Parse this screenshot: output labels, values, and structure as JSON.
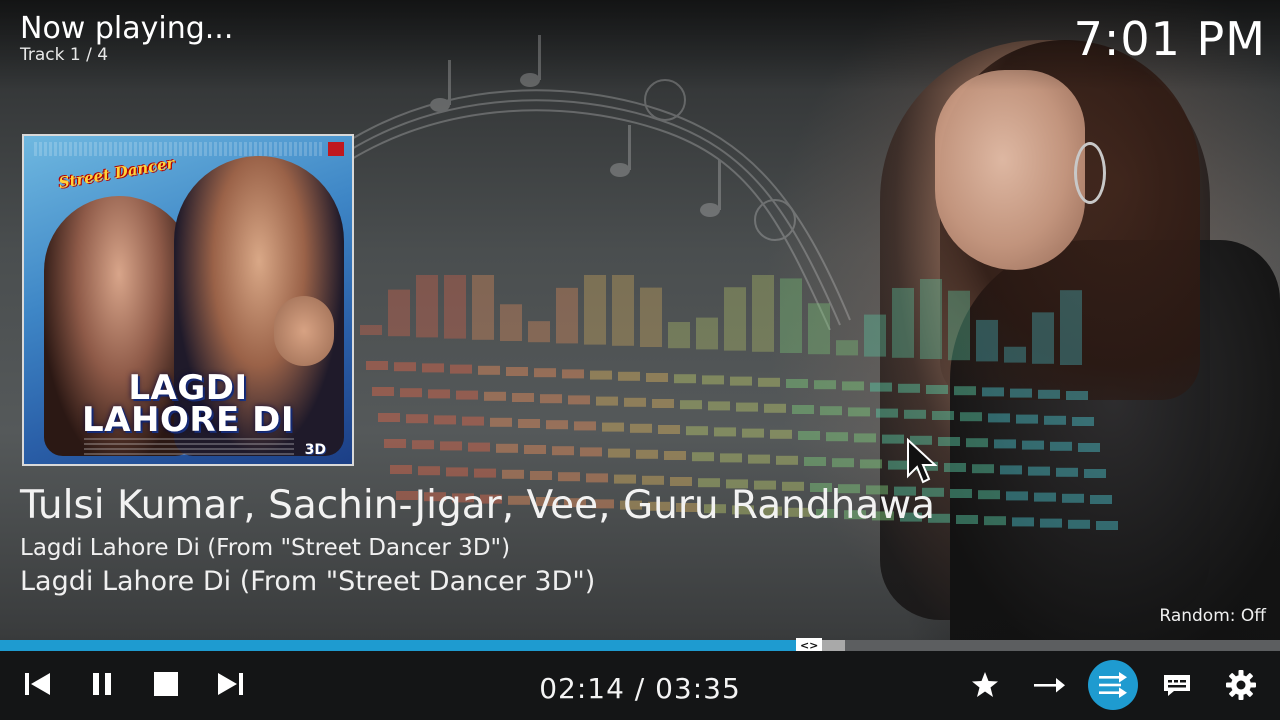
{
  "header": {
    "now_playing": "Now playing...",
    "track_count": "Track 1 / 4",
    "clock": "7:01 PM"
  },
  "album_art": {
    "title_line1": "LAGDI",
    "title_line2": "LAHORE DI",
    "badge": "3D",
    "logo": "Street Dancer"
  },
  "track": {
    "artist": "Tulsi Kumar, Sachin-Jigar, Vee, Guru Randhawa",
    "album": "Lagdi Lahore Di (From \"Street Dancer 3D\")",
    "title": "Lagdi Lahore Di (From \"Street Dancer 3D\")"
  },
  "random_status": "Random: Off",
  "progress": {
    "elapsed": "02:14",
    "total": "03:35",
    "time_display": "02:14 / 03:35",
    "fraction_played": 0.622,
    "fraction_cached": 0.66,
    "handle_glyph": "<>"
  },
  "controls": {
    "icons": [
      "previous-icon",
      "pause-icon",
      "stop-icon",
      "next-icon"
    ],
    "right_icons": [
      "favourite-star-icon",
      "repeat-arrow-icon",
      "party-mode-icon",
      "subtitles-icon",
      "settings-gear-icon"
    ]
  },
  "colors": {
    "accent": "#1e9bd0",
    "osd_background": "#141516"
  }
}
